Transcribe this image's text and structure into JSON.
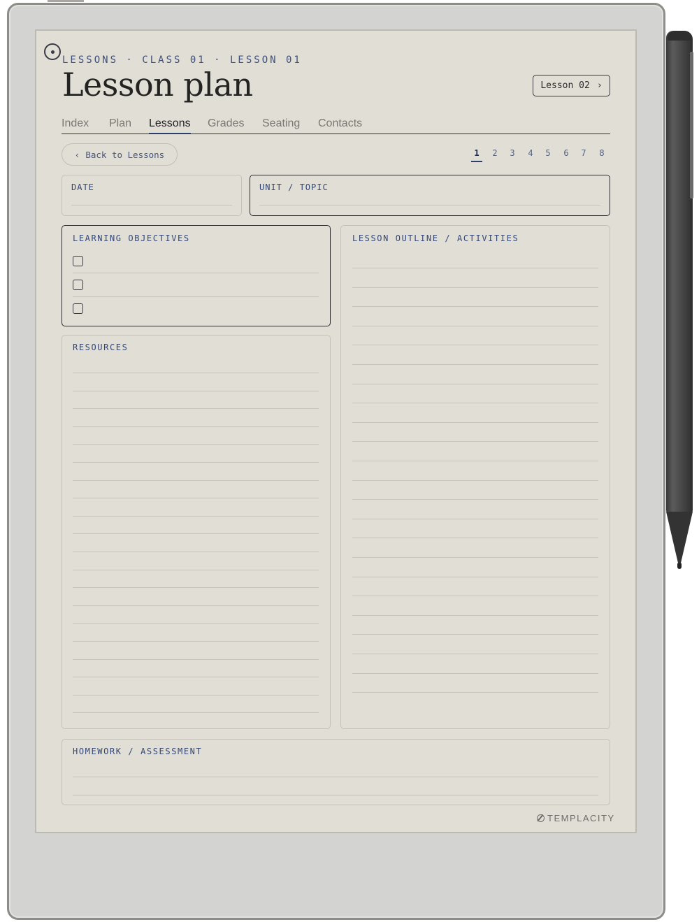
{
  "header": {
    "breadcrumb": "LESSONS · CLASS 01 · LESSON 01",
    "title": "Lesson plan",
    "next_label": "Lesson 02",
    "next_chevron": "›"
  },
  "tabs": [
    {
      "label": "Index",
      "active": false
    },
    {
      "label": "Plan",
      "active": false
    },
    {
      "label": "Lessons",
      "active": true
    },
    {
      "label": "Grades",
      "active": false
    },
    {
      "label": "Seating",
      "active": false
    },
    {
      "label": "Contacts",
      "active": false
    }
  ],
  "back": {
    "chevron": "‹",
    "label": "Back to Lessons"
  },
  "pager": {
    "pages": [
      "1",
      "2",
      "3",
      "4",
      "5",
      "6",
      "7",
      "8"
    ],
    "current": "1"
  },
  "fields": {
    "date_label": "DATE",
    "unit_label": "UNIT / TOPIC"
  },
  "sections": {
    "objectives_label": "LEARNING OBJECTIVES",
    "outline_label": "LESSON OUTLINE / ACTIVITIES",
    "resources_label": "RESOURCES",
    "homework_label": "HOMEWORK / ASSESSMENT"
  },
  "brand": "TEMPLACITY",
  "colors": {
    "accent": "#344774",
    "paper": "#e1ded6",
    "ink": "#232322"
  }
}
